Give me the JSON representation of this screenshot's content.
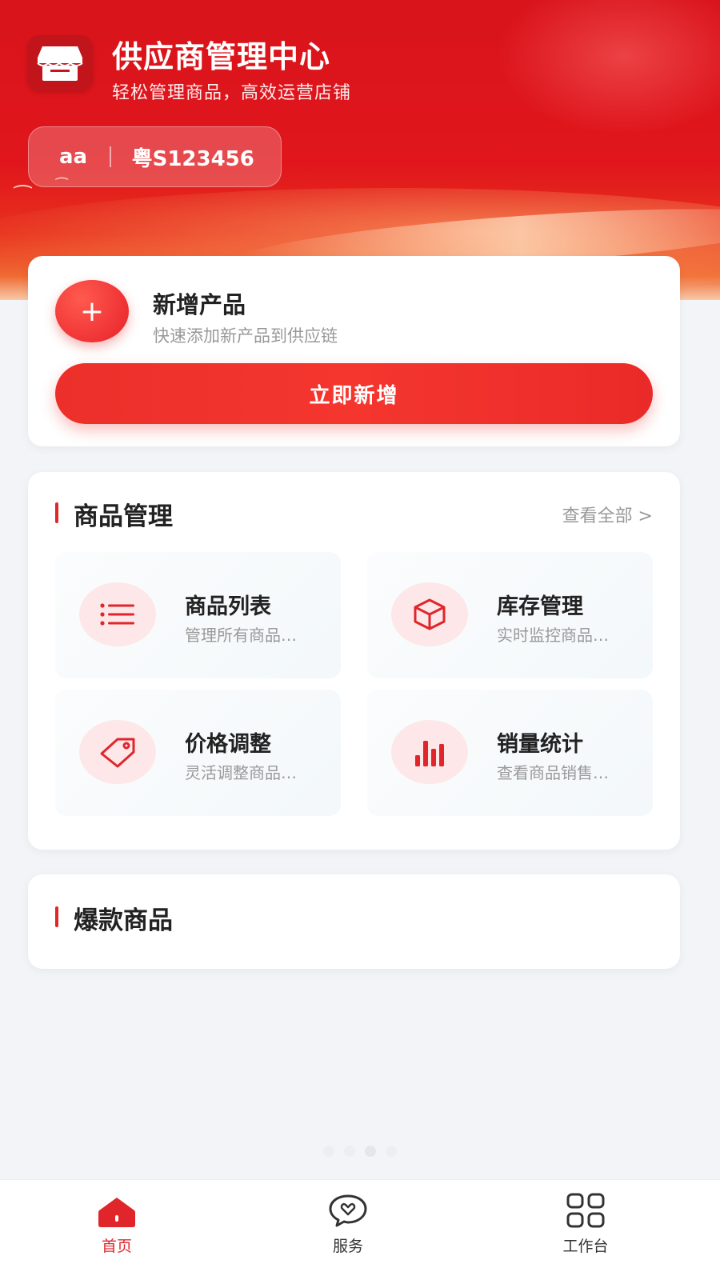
{
  "header": {
    "title": "供应商管理中心",
    "subtitle": "轻松管理商品，高效运营店铺",
    "user_name": "aa",
    "plate": "粤S123456"
  },
  "add_product": {
    "title": "新增产品",
    "description": "快速添加新产品到供应链",
    "plus": "+",
    "button_label": "立即新增"
  },
  "goods_management": {
    "title": "商品管理",
    "view_all": "查看全部 >",
    "tiles": [
      {
        "name": "商品列表",
        "desc": "管理所有商品…",
        "icon": "list-icon"
      },
      {
        "name": "库存管理",
        "desc": "实时监控商品…",
        "icon": "box-icon"
      },
      {
        "name": "价格调整",
        "desc": "灵活调整商品…",
        "icon": "tag-icon"
      },
      {
        "name": "销量统计",
        "desc": "查看商品销售…",
        "icon": "bar-chart-icon"
      }
    ]
  },
  "hot_products": {
    "title": "爆款商品"
  },
  "tabbar": {
    "items": [
      {
        "label": "首页",
        "icon": "home-icon",
        "active": true
      },
      {
        "label": "服务",
        "icon": "heart-chat-icon",
        "active": false
      },
      {
        "label": "工作台",
        "icon": "grid-icon",
        "active": false
      }
    ]
  },
  "colors": {
    "accent": "#e0262b",
    "hero_red": "#d9141b",
    "tile_icon_bg": "#fde7e8"
  }
}
